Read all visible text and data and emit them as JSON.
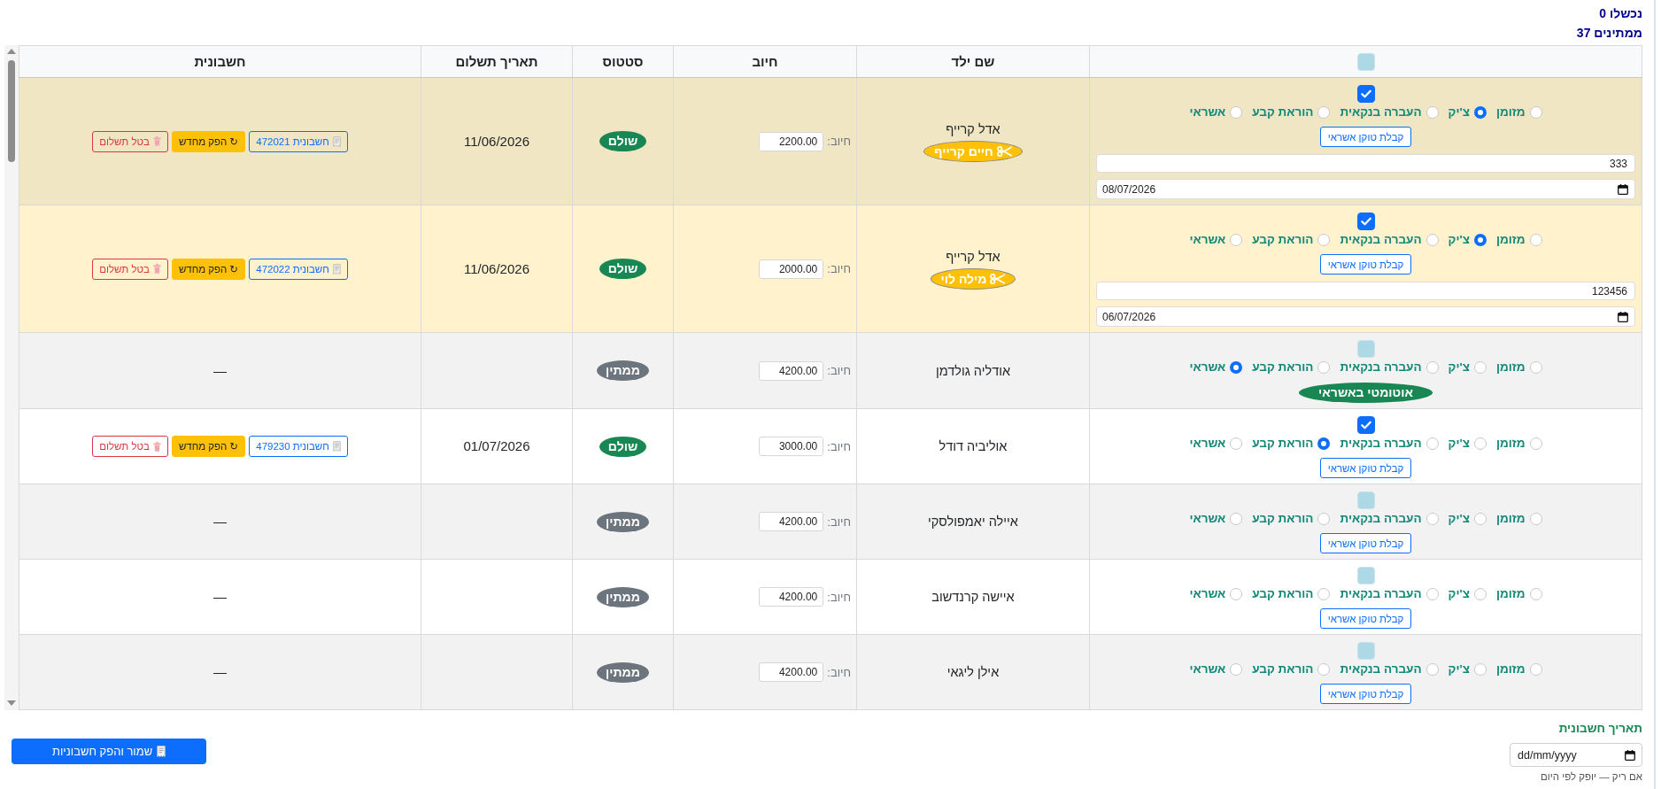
{
  "summary": {
    "failed": "נכשלו 0",
    "pending": "ממתינים 37"
  },
  "table": {
    "select_all": {
      "checked": false
    },
    "columns": [
      "שם ילד",
      "חיוב",
      "סטטוס",
      "תאריך תשלום",
      "חשבונית"
    ],
    "rows": [
      {
        "highlighted": true,
        "checked": true,
        "methods": [
          {
            "label": "מזומן",
            "selected": false
          },
          {
            "label": "צ'יק",
            "selected": true
          },
          {
            "label": "העברה בנקאית",
            "selected": false
          },
          {
            "label": "הוראת קבע",
            "selected": false
          },
          {
            "label": "אשראי",
            "selected": false
          }
        ],
        "token_button": "קבלת טוקן אשראי",
        "reference": "333",
        "date": "08/07/2026",
        "name": "אדל קרייף",
        "sibling": "חיים קרייף",
        "amount_label": "חיוב:",
        "amount": "2200.00",
        "status": {
          "label": "שולם",
          "color": "#198754"
        },
        "payment_date": "11/06/2026",
        "invoice_actions": [
          {
            "kind": "invoice",
            "label": "חשבונית 472021"
          },
          {
            "kind": "reissue",
            "label": "↻ הפק מחדש"
          },
          {
            "kind": "cancel",
            "label": "בטל תשלום"
          }
        ]
      },
      {
        "highlighted": true,
        "checked": true,
        "methods": [
          {
            "label": "מזומן",
            "selected": false
          },
          {
            "label": "צ'יק",
            "selected": true
          },
          {
            "label": "העברה בנקאית",
            "selected": false
          },
          {
            "label": "הוראת קבע",
            "selected": false
          },
          {
            "label": "אשראי",
            "selected": false
          }
        ],
        "token_button": "קבלת טוקן אשראי",
        "reference": "123456",
        "date": "06/07/2026",
        "name": "אדל קרייף",
        "sibling": "מילה לוי",
        "amount_label": "חיוב:",
        "amount": "2000.00",
        "status": {
          "label": "שולם",
          "color": "#198754"
        },
        "payment_date": "11/06/2026",
        "invoice_actions": [
          {
            "kind": "invoice",
            "label": "חשבונית 472022"
          },
          {
            "kind": "reissue",
            "label": "↻ הפק מחדש"
          },
          {
            "kind": "cancel",
            "label": "בטל תשלום"
          }
        ]
      },
      {
        "highlighted": false,
        "checked": false,
        "methods": [
          {
            "label": "מזומן",
            "selected": false
          },
          {
            "label": "צ'יק",
            "selected": false
          },
          {
            "label": "העברה בנקאית",
            "selected": false
          },
          {
            "label": "הוראת קבע",
            "selected": false
          },
          {
            "label": "אשראי",
            "selected": true
          }
        ],
        "auto_badge": "אוטומטי באשראי",
        "name": "אודליה גולדמן",
        "amount_label": "חיוב:",
        "amount": "4200.00",
        "status": {
          "label": "ממתין",
          "color": "#6c757d"
        },
        "invoice_empty": "—"
      },
      {
        "highlighted": false,
        "checked": true,
        "methods": [
          {
            "label": "מזומן",
            "selected": false
          },
          {
            "label": "צ'יק",
            "selected": false
          },
          {
            "label": "העברה בנקאית",
            "selected": false
          },
          {
            "label": "הוראת קבע",
            "selected": true
          },
          {
            "label": "אשראי",
            "selected": false
          }
        ],
        "token_button": "קבלת טוקן אשראי",
        "name": "אוליביה דודל",
        "amount_label": "חיוב:",
        "amount": "3000.00",
        "status": {
          "label": "שולם",
          "color": "#198754"
        },
        "payment_date": "01/07/2026",
        "invoice_actions": [
          {
            "kind": "invoice",
            "label": "חשבונית 479230"
          },
          {
            "kind": "reissue",
            "label": "↻ הפק מחדש"
          },
          {
            "kind": "cancel",
            "label": "בטל תשלום"
          }
        ]
      },
      {
        "highlighted": false,
        "checked": false,
        "methods": [
          {
            "label": "מזומן",
            "selected": false
          },
          {
            "label": "צ'יק",
            "selected": false
          },
          {
            "label": "העברה בנקאית",
            "selected": false
          },
          {
            "label": "הוראת קבע",
            "selected": false
          },
          {
            "label": "אשראי",
            "selected": false
          }
        ],
        "token_button": "קבלת טוקן אשראי",
        "name": "איילה יאמפולסקי",
        "amount_label": "חיוב:",
        "amount": "4200.00",
        "status": {
          "label": "ממתין",
          "color": "#6c757d"
        },
        "invoice_empty": "—"
      },
      {
        "highlighted": false,
        "checked": false,
        "methods": [
          {
            "label": "מזומן",
            "selected": false
          },
          {
            "label": "צ'יק",
            "selected": false
          },
          {
            "label": "העברה בנקאית",
            "selected": false
          },
          {
            "label": "הוראת קבע",
            "selected": false
          },
          {
            "label": "אשראי",
            "selected": false
          }
        ],
        "token_button": "קבלת טוקן אשראי",
        "name": "איישה קרנדשוב",
        "amount_label": "חיוב:",
        "amount": "4200.00",
        "status": {
          "label": "ממתין",
          "color": "#6c757d"
        },
        "invoice_empty": "—"
      },
      {
        "highlighted": false,
        "checked": false,
        "methods": [
          {
            "label": "מזומן",
            "selected": false
          },
          {
            "label": "צ'יק",
            "selected": false
          },
          {
            "label": "העברה בנקאית",
            "selected": false
          },
          {
            "label": "הוראת קבע",
            "selected": false
          },
          {
            "label": "אשראי",
            "selected": false
          }
        ],
        "token_button": "קבלת טוקן אשראי",
        "name": "אילן ליגאי",
        "amount_label": "חיוב:",
        "amount": "4200.00",
        "status": {
          "label": "ממתין",
          "color": "#6c757d"
        },
        "invoice_empty": "—"
      }
    ]
  },
  "invoice_date": {
    "label": "תאריך חשבונית",
    "placeholder": "dd/mm/yyyy",
    "hint": "אם ריק — יופק לפי היום"
  },
  "save_button": "שמור והפק חשבוניות"
}
